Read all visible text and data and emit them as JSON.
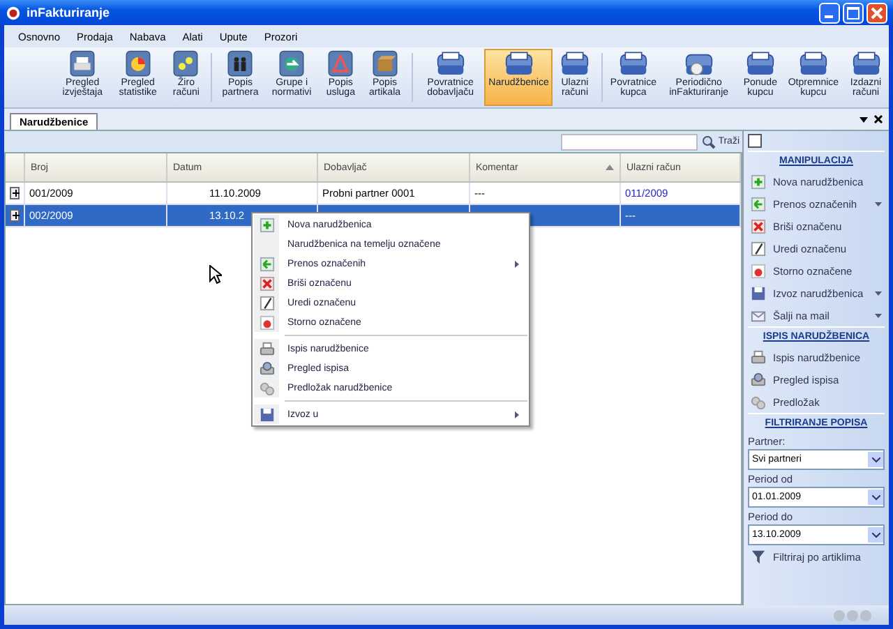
{
  "window": {
    "title": "inFakturiranje"
  },
  "menu": [
    "Osnovno",
    "Prodaja",
    "Nabava",
    "Alati",
    "Upute",
    "Prozori"
  ],
  "toolbar": [
    {
      "label": "Pregled izvještaja",
      "selected": false
    },
    {
      "label": "Pregled statistike",
      "selected": false
    },
    {
      "label": "Žiro računi",
      "selected": false
    },
    {
      "label": "Popis partnera",
      "selected": false
    },
    {
      "label": "Grupe i normativi",
      "selected": false
    },
    {
      "label": "Popis usluga",
      "selected": false
    },
    {
      "label": "Popis artikala",
      "selected": false
    },
    {
      "label": "Povratnice dobavljaču",
      "selected": false
    },
    {
      "label": "Narudžbenice",
      "selected": true
    },
    {
      "label": "Ulazni računi",
      "selected": false
    },
    {
      "label": "Povratnice kupca",
      "selected": false
    },
    {
      "label": "Periodično inFakturiranje",
      "selected": false
    },
    {
      "label": "Ponude kupcu",
      "selected": false
    },
    {
      "label": "Otpremnice kupcu",
      "selected": false
    },
    {
      "label": "Izdazni računi",
      "selected": false
    }
  ],
  "document_tab": {
    "label": "Narudžbenice",
    "selected": true
  },
  "search": {
    "button": "Traži"
  },
  "table": {
    "columns": [
      "Broj",
      "Datum",
      "Dobavljač",
      "Komentar",
      "Ulazni račun"
    ],
    "rows": [
      {
        "selected": false,
        "cells": [
          "001/2009",
          "11.10.2009",
          "Probni partner 0001",
          "---",
          "011/2009"
        ]
      },
      {
        "selected": true,
        "cells": [
          "002/2009",
          "13.10.2",
          "",
          "",
          "---"
        ]
      }
    ]
  },
  "context_menu": [
    [
      {
        "label": "Nova narudžbenica",
        "submenu": false
      },
      {
        "label": "Narudžbenica na temelju označene",
        "submenu": false
      },
      {
        "label": "Prenos označenih",
        "submenu": true
      },
      {
        "label": "Briši označenu",
        "submenu": false
      },
      {
        "label": "Uredi označenu",
        "submenu": false
      },
      {
        "label": "Storno označene",
        "submenu": false
      }
    ],
    [
      {
        "label": "Ispis narudžbenice",
        "submenu": false
      },
      {
        "label": "Pregled ispisa",
        "submenu": false
      },
      {
        "label": "Predložak narudžbenice",
        "submenu": false
      }
    ],
    [
      {
        "label": "Izvoz u",
        "submenu": true
      }
    ]
  ],
  "sidebar": {
    "manipulacija": {
      "title": "MANIPULACIJA",
      "items": [
        {
          "label": "Nova narudžbenica",
          "dropdown": false
        },
        {
          "label": "Prenos označenih",
          "dropdown": true
        },
        {
          "label": "Briši označenu",
          "dropdown": false
        },
        {
          "label": "Uredi označenu",
          "dropdown": false
        },
        {
          "label": "Storno označene",
          "dropdown": false
        },
        {
          "label": "Izvoz narudžbenica",
          "dropdown": true
        },
        {
          "label": "Šalji na mail",
          "dropdown": true
        }
      ]
    },
    "ispis": {
      "title": "ISPIS NARUDŽBENICA",
      "items": [
        {
          "label": "Ispis narudžbenice"
        },
        {
          "label": "Pregled ispisa"
        },
        {
          "label": "Predložak"
        }
      ]
    },
    "filtriranje": {
      "title": "FILTRIRANJE POPISA",
      "fields": [
        {
          "label": "Partner:",
          "value": "Svi partneri"
        },
        {
          "label": "Period od",
          "value": "01.01.2009"
        },
        {
          "label": "Period do",
          "value": "13.10.2009"
        }
      ],
      "filter_link": "Filtriraj po artiklima"
    }
  }
}
